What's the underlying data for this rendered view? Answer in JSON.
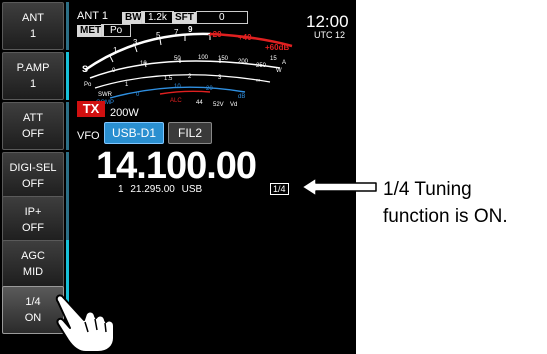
{
  "sidebar": {
    "items": [
      {
        "title": "ANT",
        "value": "1"
      },
      {
        "title": "P.AMP",
        "value": "1"
      },
      {
        "title": "ATT",
        "value": "OFF"
      },
      {
        "title": "DIGI-SEL",
        "value": "OFF"
      },
      {
        "title": "IP+",
        "value": "OFF"
      },
      {
        "title": "AGC",
        "value": "MID"
      },
      {
        "title": "1/4",
        "value": "ON"
      }
    ]
  },
  "header": {
    "antenna": "ANT 1",
    "bw_label": "BW",
    "bw_value": "1.2k",
    "sft_label": "SFT",
    "sft_value": "0",
    "met_label": "MET",
    "met_value": "Po",
    "clock": "12:00",
    "utc": "UTC 12"
  },
  "meter": {
    "s_scale": [
      "S",
      "1",
      "3",
      "5",
      "7",
      "9",
      "+20",
      "+40",
      "+60dB"
    ],
    "po_scale": [
      "Po",
      "0",
      "10",
      "50",
      "100",
      "150",
      "200",
      "250",
      "W"
    ],
    "swr_scale": [
      "SWR",
      "1",
      "1.5",
      "2",
      "3",
      "∞"
    ],
    "alc_label": "ALC",
    "comp_scale": [
      "COMP",
      "0",
      "10",
      "20",
      "dB"
    ],
    "id_vd_scale": [
      "15",
      "A",
      "44",
      "52V",
      "Vd"
    ],
    "colors": {
      "red": "#e02020",
      "blue": "#2f8fe0",
      "white": "#ffffff"
    }
  },
  "tx": {
    "label": "TX",
    "power": "200W"
  },
  "vfo": {
    "label": "VFO",
    "mode": "USB-D1",
    "filter": "FIL2"
  },
  "frequency": {
    "main": "14.100.00",
    "sub_vfo": "1",
    "sub_freq": "21.295.00",
    "sub_mode": "USB"
  },
  "quarter_indicator": "1/4",
  "callout": {
    "line1": "1/4 Tuning",
    "line2": "function is ON."
  }
}
